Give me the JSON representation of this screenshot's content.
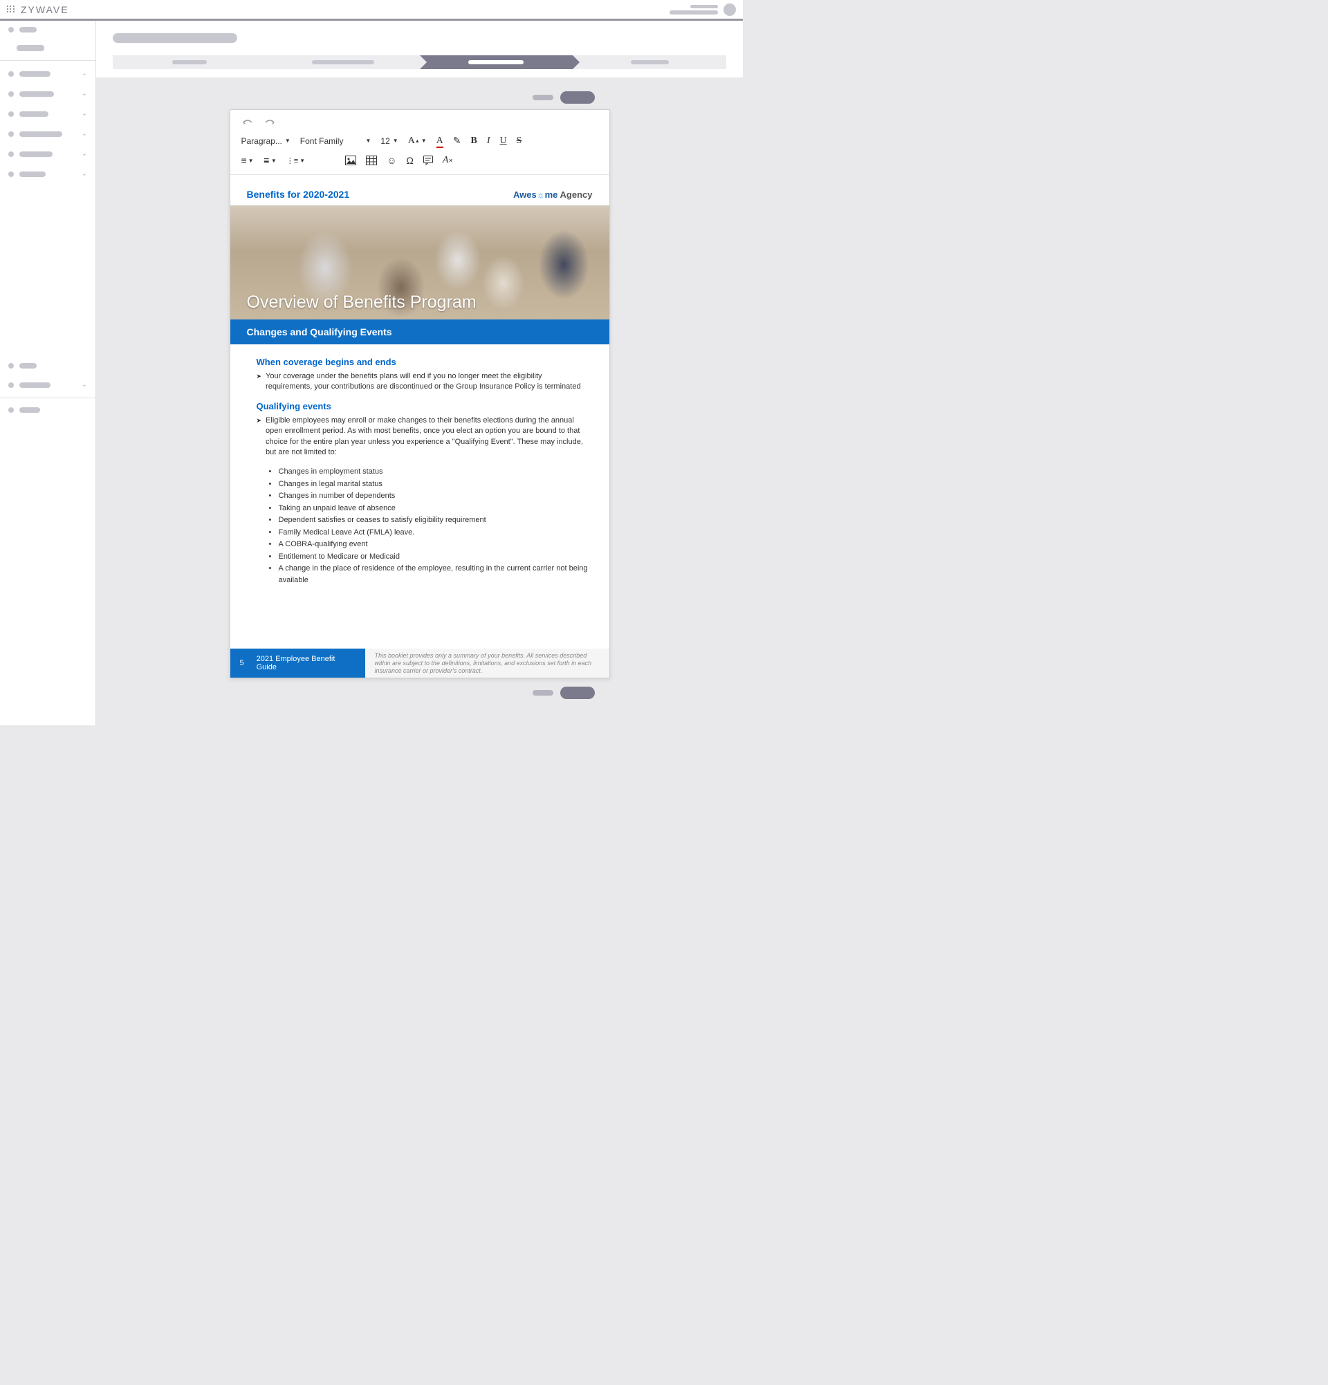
{
  "brand": "ZYWAVE",
  "toolbar": {
    "paragraph": "Paragrap...",
    "font_family": "Font Family",
    "font_size": "12"
  },
  "document": {
    "header_title": "Benefits for 2020-2021",
    "agency_1": "Awes",
    "agency_2": "me",
    "agency_3": " Agency",
    "hero_title": "Overview of Benefits Program",
    "blue_bar": "Changes and Qualifying Events",
    "section1_title": "When coverage begins and ends",
    "section1_text": "Your coverage under the benefits plans will end if you no longer meet the eligibility requirements, your contributions are discontinued or the Group Insurance Policy is terminated",
    "section2_title": "Qualifying events",
    "section2_text": "Eligible employees may enroll or make changes to their benefits elections during the annual open enrollment period. As with most benefits, once you elect an option you are bound to that choice for the entire plan year unless you experience a \"Qualifying Event\". These may include, but are not limited to:",
    "bullets": [
      "Changes in employment status",
      "Changes in legal marital status",
      "Changes in number of dependents",
      "Taking an unpaid leave of absence",
      "Dependent satisfies or ceases to satisfy eligibility requirement",
      "Family Medical Leave Act (FMLA) leave.",
      "A COBRA-qualifying event",
      "Entitlement to Medicare or Medicaid",
      "A change in the place of residence of the employee, resulting in the current carrier not being available"
    ],
    "footer_page": "5",
    "footer_title": "2021 Employee Benefit Guide",
    "footer_disclaimer": "This booklet provides only a summary of your benefits. All services described within are subject to the definitions, limitations, and exclusions set forth in each insurance carrier or provider's contract."
  }
}
